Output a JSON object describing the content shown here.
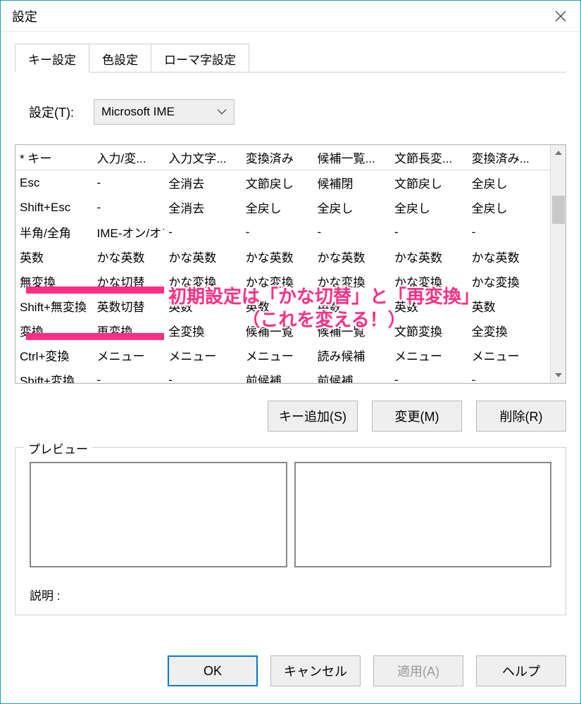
{
  "window_title": "設定",
  "tabs": [
    "キー設定",
    "色設定",
    "ローマ字設定"
  ],
  "active_tab": 0,
  "setting_label": "設定(T):",
  "select_value": "Microsoft IME",
  "columns": [
    "* キー",
    "入力/変...",
    "入力文字...",
    "変換済み",
    "候補一覧...",
    "文節長変...",
    "変換済み..."
  ],
  "rows": [
    [
      "Esc",
      "-",
      "全消去",
      "文節戻し",
      "候補閉",
      "文節戻し",
      "全戻し"
    ],
    [
      "Shift+Esc",
      "-",
      "全消去",
      "全戻し",
      "全戻し",
      "全戻し",
      "全戻し"
    ],
    [
      "半角/全角",
      "IME-オン/オフ",
      "-",
      "-",
      "-",
      "-",
      "-"
    ],
    [
      "英数",
      "かな英数",
      "かな英数",
      "かな英数",
      "かな英数",
      "かな英数",
      "かな英数"
    ],
    [
      "無変換",
      "かな切替",
      "かな変換",
      "かな変換",
      "かな変換",
      "かな変換",
      "かな変換"
    ],
    [
      "Shift+無変換",
      "英数切替",
      "英数",
      "英数",
      "英数",
      "英数",
      "英数"
    ],
    [
      "変換",
      "再変換",
      "全変換",
      "候補一覧",
      "候補一覧",
      "文節変換",
      "全変換"
    ],
    [
      "Ctrl+変換",
      "メニュー",
      "メニュー",
      "メニュー",
      "読み候補",
      "メニュー",
      "メニュー"
    ],
    [
      "Shift+変換",
      "-",
      "-",
      "前候補",
      "前候補",
      "-",
      "-"
    ]
  ],
  "row_buttons": {
    "add": "キー追加(S)",
    "modify": "変更(M)",
    "delete": "削除(R)"
  },
  "preview": {
    "legend": "プレビュー",
    "desc_label": "説明 :"
  },
  "dlg_buttons": {
    "ok": "OK",
    "cancel": "キャンセル",
    "apply": "適用(A)",
    "help": "ヘルプ"
  },
  "annotation": {
    "line1": "初期設定は「かな切替」と「再変換」",
    "line2": "（これを変える！）"
  }
}
